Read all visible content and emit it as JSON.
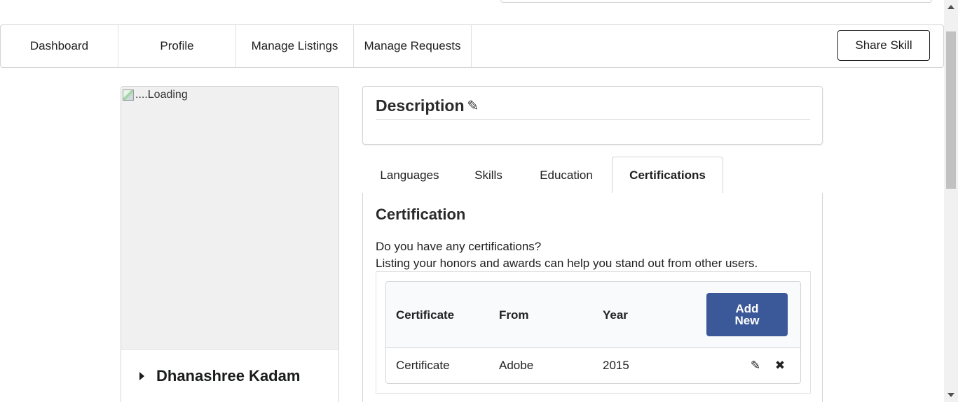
{
  "nav": {
    "items": [
      "Dashboard",
      "Profile",
      "Manage Listings",
      "Manage Requests"
    ],
    "share_label": "Share Skill"
  },
  "profile": {
    "image_alt": "....Loading",
    "name": "Dhanashree Kadam"
  },
  "description": {
    "title": "Description"
  },
  "tabs": [
    {
      "label": "Languages",
      "active": false
    },
    {
      "label": "Skills",
      "active": false
    },
    {
      "label": "Education",
      "active": false
    },
    {
      "label": "Certifications",
      "active": true
    }
  ],
  "certification": {
    "title": "Certification",
    "line1": "Do you have any certifications?",
    "line2": "Listing your honors and awards can help you stand out from other users.",
    "columns": [
      "Certificate",
      "From",
      "Year"
    ],
    "add_label": "Add New",
    "rows": [
      {
        "certificate": "Certificate",
        "from": "Adobe",
        "year": "2015"
      }
    ]
  },
  "colors": {
    "primary_button": "#3b5998",
    "border": "#d4d4d5"
  },
  "icons": {
    "edit": "pencil-icon",
    "delete": "close-icon"
  }
}
